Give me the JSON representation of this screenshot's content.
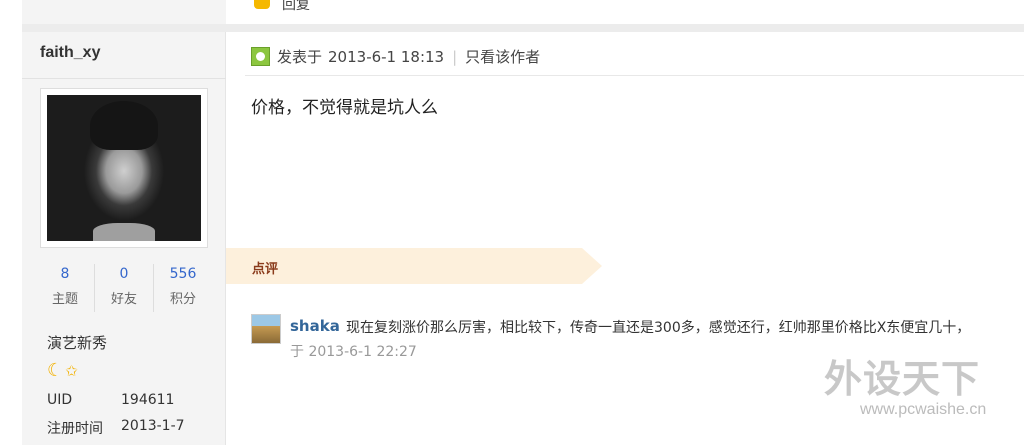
{
  "prev_post": {
    "reply_label": "回复"
  },
  "sidebar": {
    "username": "faith_xy",
    "stats": [
      {
        "value": "8",
        "label": "主题"
      },
      {
        "value": "0",
        "label": "好友"
      },
      {
        "value": "556",
        "label": "积分"
      }
    ],
    "rank": "演艺新秀",
    "info": [
      {
        "key": "UID",
        "value": "194611"
      },
      {
        "key": "注册时间",
        "value": "2013-1-7"
      }
    ]
  },
  "post": {
    "posted_prefix": "发表于",
    "posted_time": "2013-6-1 18:13",
    "divider": "|",
    "author_only": "只看该作者",
    "content": "价格，不觉得就是坑人么"
  },
  "comments": {
    "section_label": "点评",
    "items": [
      {
        "user": "shaka",
        "text": "现在复刻涨价那么厉害，相比较下，传奇一直还是300多，感觉还行，红帅那里价格比X东便宜几十，",
        "time": "于 2013-6-1 22:27"
      }
    ]
  },
  "watermark": {
    "title": "外设天下",
    "url": "www.pcwaishe.cn"
  },
  "colors": {
    "link": "#336699",
    "stat": "#3366cc",
    "comment_band": "#fdf0dc",
    "comment_label": "#8a3b1b",
    "icon_green": "#8cc63f"
  }
}
